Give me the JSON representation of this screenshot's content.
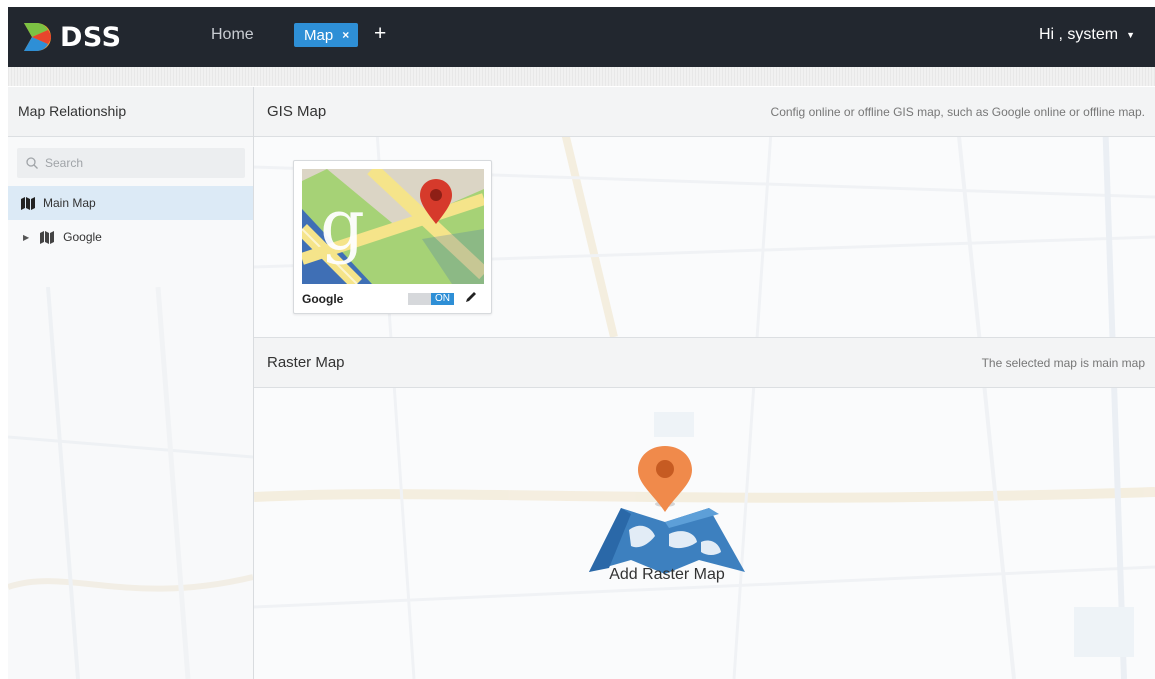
{
  "app": {
    "brand": "DSS",
    "accent": "#2e8fd6"
  },
  "topnav": {
    "home_label": "Home",
    "active_tab_label": "Map",
    "close_glyph": "×",
    "add_glyph": "+",
    "user_label": "Hi , system",
    "user_caret": "▼"
  },
  "sidebar": {
    "title": "Map Relationship",
    "search_placeholder": "Search",
    "items": [
      {
        "label": "Main Map",
        "icon": "map-icon",
        "selected": true
      },
      {
        "label": "Google",
        "icon": "map-icon",
        "expandable": true
      }
    ]
  },
  "gis": {
    "title": "GIS Map",
    "description": "Config online or offline GIS map, such as Google online or offline map.",
    "card": {
      "label": "Google",
      "toggle_on": "ON",
      "enabled": true
    }
  },
  "raster": {
    "title": "Raster Map",
    "description": "The selected map is main map",
    "add_label": "Add Raster Map"
  }
}
